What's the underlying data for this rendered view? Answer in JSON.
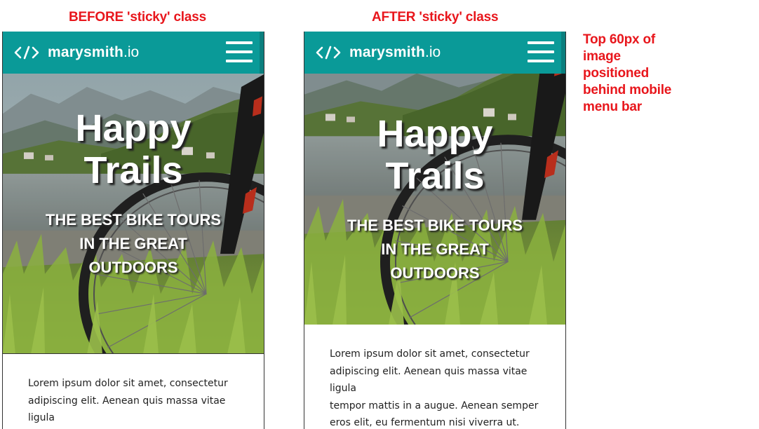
{
  "captions": {
    "before": "BEFORE 'sticky' class",
    "after": "AFTER 'sticky' class",
    "note": "Top 60px of image positioned behind mobile menu bar"
  },
  "site": {
    "brand_name": "marysmith",
    "brand_tld": ".io",
    "logo_icon": "code-brackets-icon",
    "menu_icon": "hamburger-menu-icon",
    "nav_color": "#0a9a98"
  },
  "hero": {
    "title_line1": "Happy",
    "title_line2": "Trails",
    "subtitle": "THE BEST BIKE TOURS IN THE GREAT OUTDOORS"
  },
  "before_body": {
    "lines": [
      "Lorem ipsum dolor sit amet, consectetur",
      "adipiscing elit. Aenean quis massa vitae ligula"
    ]
  },
  "after_body": {
    "lines": [
      "Lorem ipsum dolor sit amet, consectetur",
      "adipiscing elit. Aenean quis massa vitae ligula",
      "tempor mattis in a augue. Aenean semper",
      "eros elit, eu fermentum nisi viverra ut."
    ]
  }
}
